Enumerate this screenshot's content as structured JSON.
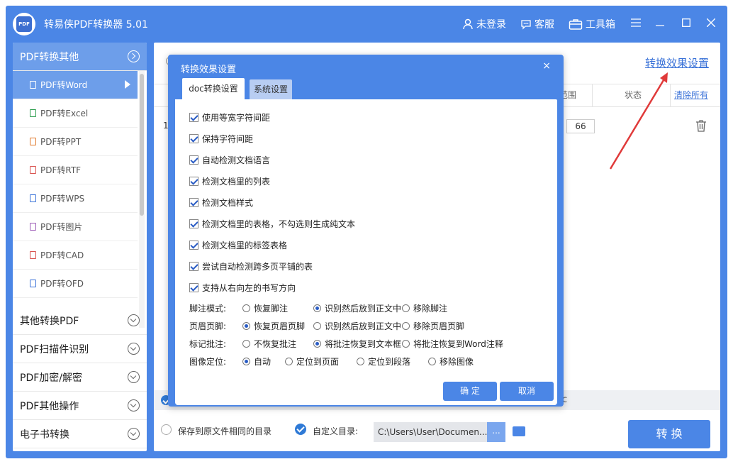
{
  "app": {
    "title": "转易侠PDF转换器 5.01",
    "logo_text": "PDF"
  },
  "titlebar": {
    "login": "未登录",
    "service": "客服",
    "toolbox": "工具箱"
  },
  "sidebar": {
    "groups": [
      {
        "label": "PDF转换其他",
        "active": true
      },
      {
        "label": "其他转换PDF"
      },
      {
        "label": "PDF扫描件识别"
      },
      {
        "label": "PDF加密/解密"
      },
      {
        "label": "PDF其他操作"
      },
      {
        "label": "电子书转换"
      }
    ],
    "subitems": [
      {
        "label": "PDF转Word",
        "active": true,
        "color": "#ffffff"
      },
      {
        "label": "PDF转Excel",
        "color": "#2e9e4f"
      },
      {
        "label": "PDF转PPT",
        "color": "#e0782a"
      },
      {
        "label": "PDF转RTF",
        "color": "#d9534f"
      },
      {
        "label": "PDF转WPS",
        "color": "#3a72d8"
      },
      {
        "label": "PDF转图片",
        "color": "#9b59b6"
      },
      {
        "label": "PDF转CAD",
        "color": "#d9534f"
      },
      {
        "label": "PDF转OFD",
        "color": "#3a72d8"
      }
    ]
  },
  "main": {
    "settings_link": "转换效果设置",
    "columns": {
      "range": "范围",
      "status": "状态",
      "clear": "清除所有"
    },
    "row": {
      "index": "1",
      "pages": "66"
    },
    "output": {
      "same_dir": "保存到原文件相同的目录",
      "custom_dir": "自定义目录:",
      "path": "C:\\Users\\User\\Documen...",
      "browse": "...",
      "trailing": "c"
    },
    "convert_button": "转 换"
  },
  "dialog": {
    "title": "转换效果设置",
    "close": "×",
    "tabs": {
      "doc": "doc转换设置",
      "system": "系统设置"
    },
    "checkboxes": [
      "使用等宽字符间距",
      "保持字符间距",
      "自动检测文档语言",
      "检测文档里的列表",
      "检测文档样式",
      "检测文档里的表格，不勾选则生成纯文本",
      "检测文档里的标签表格",
      "尝试自动检测跨多页平铺的表",
      "支持从右向左的书写方向"
    ],
    "options": [
      {
        "label": "脚注模式:",
        "choices": [
          "恢复脚注",
          "识别然后放到正文中",
          "移除脚注"
        ],
        "selected": 1
      },
      {
        "label": "页眉页脚:",
        "choices": [
          "恢复页眉页脚",
          "识别然后放到正文中",
          "移除页眉页脚"
        ],
        "selected": 0
      },
      {
        "label": "标记批注:",
        "choices": [
          "不恢复批注",
          "将批注恢复到文本框",
          "将批注恢复到Word注释"
        ],
        "selected": 1
      },
      {
        "label": "图像定位:",
        "choices": [
          "自动",
          "定位到页面",
          "定位到段落",
          "移除图像"
        ],
        "selected": 0
      }
    ],
    "ok": "确 定",
    "cancel": "取消"
  },
  "annotation": {
    "arrow_color": "#e03a3a"
  }
}
